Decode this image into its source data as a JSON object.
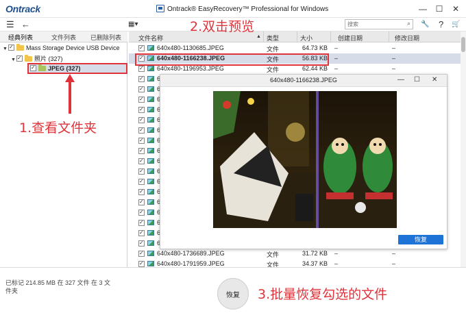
{
  "brand": "Ontrack",
  "window": {
    "title": "Ontrack® EasyRecovery™ Professional for Windows",
    "minimize": "—",
    "maximize": "☐",
    "close": "✕"
  },
  "toolbar": {
    "menu_icon": "☰",
    "back_icon": "←",
    "view_icon": "▦▾",
    "search_placeholder": "搜索",
    "wrench_icon": "🔧",
    "help_icon": "?",
    "cart_icon": "🛒"
  },
  "left_tabs": [
    "经典列表",
    "文件列表",
    "已删除列表"
  ],
  "tree": {
    "root": "Mass Storage Device USB Device",
    "photos": "照片 (327)",
    "jpeg": "JPEG (327)"
  },
  "table": {
    "headers": [
      "文件名称",
      "类型",
      "大小",
      "创建日期",
      "修改日期"
    ],
    "rows": [
      {
        "name": "640x480-1130685.JPEG",
        "type": "文件",
        "size": "64.73 KB",
        "created": "–",
        "modified": "–",
        "selected": false
      },
      {
        "name": "640x480-1166238.JPEG",
        "type": "文件",
        "size": "56.83 KB",
        "created": "–",
        "modified": "–",
        "selected": true
      },
      {
        "name": "640x480-1196953.JPEG",
        "type": "文件",
        "size": "62.44 KB",
        "created": "–",
        "modified": "–",
        "selected": false
      },
      {
        "name": "6",
        "type": "",
        "size": "",
        "created": "",
        "modified": "",
        "selected": false
      },
      {
        "name": "6",
        "type": "",
        "size": "",
        "created": "",
        "modified": "",
        "selected": false
      },
      {
        "name": "6",
        "type": "",
        "size": "",
        "created": "",
        "modified": "",
        "selected": false
      },
      {
        "name": "6",
        "type": "",
        "size": "",
        "created": "",
        "modified": "",
        "selected": false
      },
      {
        "name": "6",
        "type": "",
        "size": "",
        "created": "",
        "modified": "",
        "selected": false
      },
      {
        "name": "6",
        "type": "",
        "size": "",
        "created": "",
        "modified": "",
        "selected": false
      },
      {
        "name": "6",
        "type": "",
        "size": "",
        "created": "",
        "modified": "",
        "selected": false
      },
      {
        "name": "6",
        "type": "",
        "size": "",
        "created": "",
        "modified": "",
        "selected": false
      },
      {
        "name": "6",
        "type": "",
        "size": "",
        "created": "",
        "modified": "",
        "selected": false
      },
      {
        "name": "6",
        "type": "",
        "size": "",
        "created": "",
        "modified": "",
        "selected": false
      },
      {
        "name": "6",
        "type": "",
        "size": "",
        "created": "",
        "modified": "",
        "selected": false
      },
      {
        "name": "6",
        "type": "",
        "size": "",
        "created": "",
        "modified": "",
        "selected": false
      },
      {
        "name": "6",
        "type": "",
        "size": "",
        "created": "",
        "modified": "",
        "selected": false
      },
      {
        "name": "6",
        "type": "",
        "size": "",
        "created": "",
        "modified": "",
        "selected": false
      },
      {
        "name": "6",
        "type": "",
        "size": "",
        "created": "",
        "modified": "",
        "selected": false
      },
      {
        "name": "6",
        "type": "",
        "size": "",
        "created": "",
        "modified": "",
        "selected": false
      },
      {
        "name": "6",
        "type": "",
        "size": "",
        "created": "",
        "modified": "",
        "selected": false
      },
      {
        "name": "640x480-1736689.JPEG",
        "type": "文件",
        "size": "31.72 KB",
        "created": "–",
        "modified": "–",
        "selected": false
      },
      {
        "name": "640x480-1791959.JPEG",
        "type": "文件",
        "size": "34.37 KB",
        "created": "–",
        "modified": "–",
        "selected": false
      }
    ]
  },
  "preview": {
    "title": "640x480-1166238.JPEG",
    "minimize": "—",
    "maximize": "☐",
    "close": "✕",
    "restore_label": "恢复"
  },
  "status_text": "已标记 214.85 MB 在 327 文件 在 3 文件夹",
  "restore_button": "恢复",
  "annotations": {
    "step1": "1.查看文件夹",
    "step2": "2.双击预览",
    "step3": "3.批量恢复勾选的文件"
  },
  "colors": {
    "accent": "#1e73d6",
    "highlight": "#e0323a",
    "selection": "#d6dde8",
    "brand": "#1f4e8c"
  }
}
